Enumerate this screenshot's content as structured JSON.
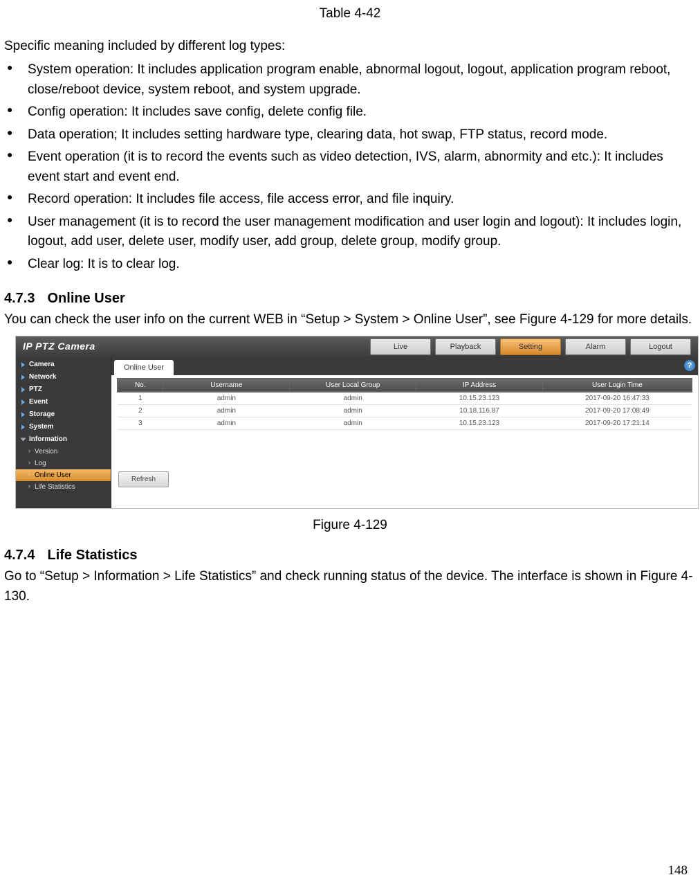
{
  "tableCaption": "Table 4-42",
  "introLine": "Specific meaning included by different log types:",
  "bullets": [
    "System operation: It includes application program enable, abnormal logout, logout, application program reboot, close/reboot device, system reboot, and system upgrade.",
    "Config operation: It includes save config, delete config file.",
    "Data operation; It includes setting hardware type, clearing data, hot swap, FTP status, record mode.",
    "Event operation (it is to record the events such as video detection, IVS, alarm, abnormity and etc.): It includes event start and event end.",
    "Record operation: It includes file access, file access error, and file inquiry.",
    "User management (it is to record the user management modification and user login and logout): It includes login, logout, add user, delete user, modify user, add group, delete group, modify group.",
    "Clear log: It is to clear log."
  ],
  "section473": {
    "num": "4.7.3",
    "title": "Online User"
  },
  "section473_para": "You can check the user info on the current WEB in “Setup > System > Online User”, see Figure 4-129 for more details.",
  "ui": {
    "brand": "IP PTZ Camera",
    "nav": [
      "Live",
      "Playback",
      "Setting",
      "Alarm",
      "Logout"
    ],
    "navActiveIndex": 2,
    "sidebarMain": [
      "Camera",
      "Network",
      "PTZ",
      "Event",
      "Storage",
      "System",
      "Information"
    ],
    "sidebarSubs": [
      "Version",
      "Log",
      "Online User",
      "Life Statistics"
    ],
    "sidebarSelectedSub": "Online User",
    "tabLabel": "Online User",
    "tableHeaders": [
      "No.",
      "Username",
      "User Local Group",
      "IP Address",
      "User Login Time"
    ],
    "tableRows": [
      [
        "1",
        "admin",
        "admin",
        "10.15.23.123",
        "2017-09-20 16:47:33"
      ],
      [
        "2",
        "admin",
        "admin",
        "10.18.116.87",
        "2017-09-20 17:08:49"
      ],
      [
        "3",
        "admin",
        "admin",
        "10.15.23.123",
        "2017-09-20 17:21:14"
      ]
    ],
    "refreshLabel": "Refresh",
    "helpGlyph": "?"
  },
  "figureCaption": "Figure 4-129",
  "section474": {
    "num": "4.7.4",
    "title": "Life Statistics"
  },
  "section474_para": "Go to “Setup > Information > Life Statistics” and check running status of the device. The interface is shown in Figure 4-130.",
  "pageNumber": "148"
}
